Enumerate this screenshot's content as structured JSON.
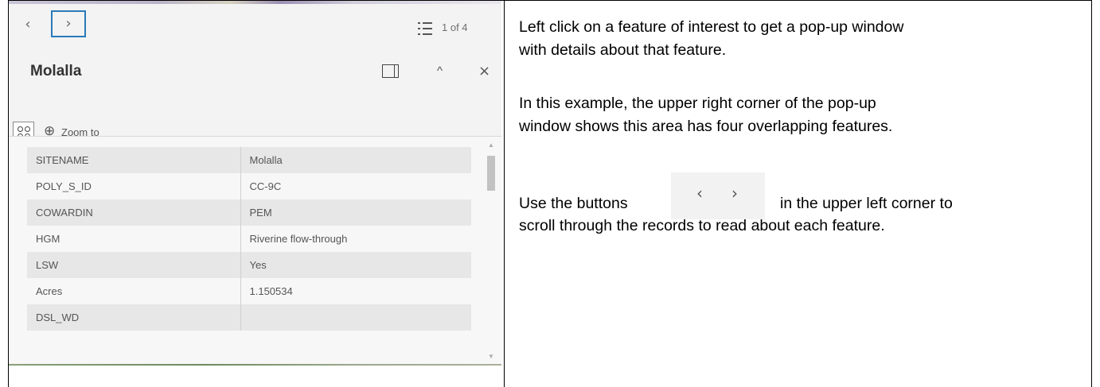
{
  "popup": {
    "nav": {
      "prev_icon": "‹",
      "next_icon": "›",
      "count": "1 of 4"
    },
    "title": "Molalla",
    "collapse_icon": "^",
    "close_icon": "×",
    "actions": {
      "zoom_icon": "⊕",
      "zoom_label": "Zoom to"
    },
    "attributes": [
      {
        "key": "SITENAME",
        "value": "Molalla"
      },
      {
        "key": "POLY_S_ID",
        "value": "CC-9C"
      },
      {
        "key": "COWARDIN",
        "value": "PEM"
      },
      {
        "key": "HGM",
        "value": "Riverine flow-through"
      },
      {
        "key": "LSW",
        "value": "Yes"
      },
      {
        "key": "Acres",
        "value": "1.150534"
      },
      {
        "key": "DSL_WD",
        "value": ""
      }
    ],
    "scroll_up_icon": "▲",
    "scroll_down_icon": "▼"
  },
  "instructions": {
    "p1_line1": "Left click on a feature of interest to get a pop-up window",
    "p1_line2": "with details about that feature.",
    "p2_line1": "In this example, the upper right corner of the pop-up",
    "p2_line2": "window shows this area has four overlapping features.",
    "p3_before": "Use the buttons",
    "p3_buttons": {
      "prev_icon": "‹",
      "next_icon": "›"
    },
    "p3_after": "in the upper left corner to",
    "p3_line2": "scroll through the records to read about each feature."
  },
  "colors": {
    "focus_outline": "#2a7ab8",
    "row_shaded": "#e7e7e7",
    "panel_bg": "#f3f3f3"
  }
}
